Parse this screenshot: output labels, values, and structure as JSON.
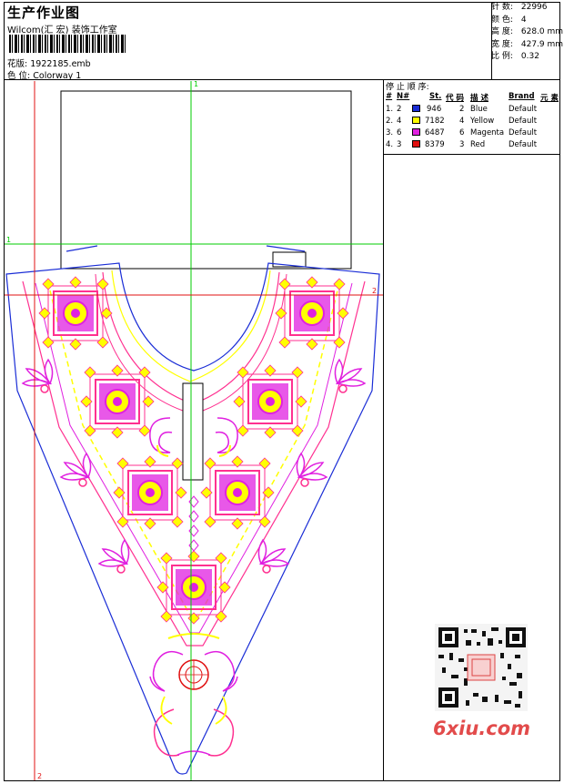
{
  "header": {
    "title": "生产作业图",
    "company": "Wilcom(汇 宏) 装饰工作室",
    "design_label": "花版:",
    "design_value": "1922185.emb",
    "colorway_label": "色 位:",
    "colorway_value": "Colorway 1"
  },
  "specs": {
    "stitches_label": "针 数:",
    "stitches_value": "22996",
    "colors_label": "颜 色:",
    "colors_value": "4",
    "height_label": "高 度:",
    "height_value": "628.0 mm",
    "width_label": "宽 度:",
    "width_value": "427.9 mm",
    "scale_label": "比 例:",
    "scale_value": "0.32"
  },
  "stop_sequence": {
    "caption": "停 止 顺 序:",
    "headers": {
      "num": "#",
      "n": "N#",
      "st": "St.",
      "code": "代 码",
      "desc": "描 述",
      "brand": "Brand",
      "element": "元 素"
    },
    "rows": [
      {
        "num": "1.",
        "n": "2",
        "st": "946",
        "code": "2",
        "desc": "Blue",
        "brand": "Default",
        "color": "#1a2dd6"
      },
      {
        "num": "2.",
        "n": "4",
        "st": "7182",
        "code": "4",
        "desc": "Yellow",
        "brand": "Default",
        "color": "#ffff00"
      },
      {
        "num": "3.",
        "n": "6",
        "st": "6487",
        "code": "6",
        "desc": "Magenta",
        "brand": "Default",
        "color": "#e020e0"
      },
      {
        "num": "4.",
        "n": "3",
        "st": "8379",
        "code": "3",
        "desc": "Red",
        "brand": "Default",
        "color": "#e01010"
      }
    ]
  },
  "guides": {
    "green_1": "1",
    "red_2": "2"
  },
  "watermark": "6xiu.com",
  "colors": {
    "blue": "#1a2dd6",
    "yellow": "#ffff00",
    "magenta": "#e020e0",
    "red": "#e01010",
    "pink": "#ff3090",
    "green": "#00cc00"
  }
}
